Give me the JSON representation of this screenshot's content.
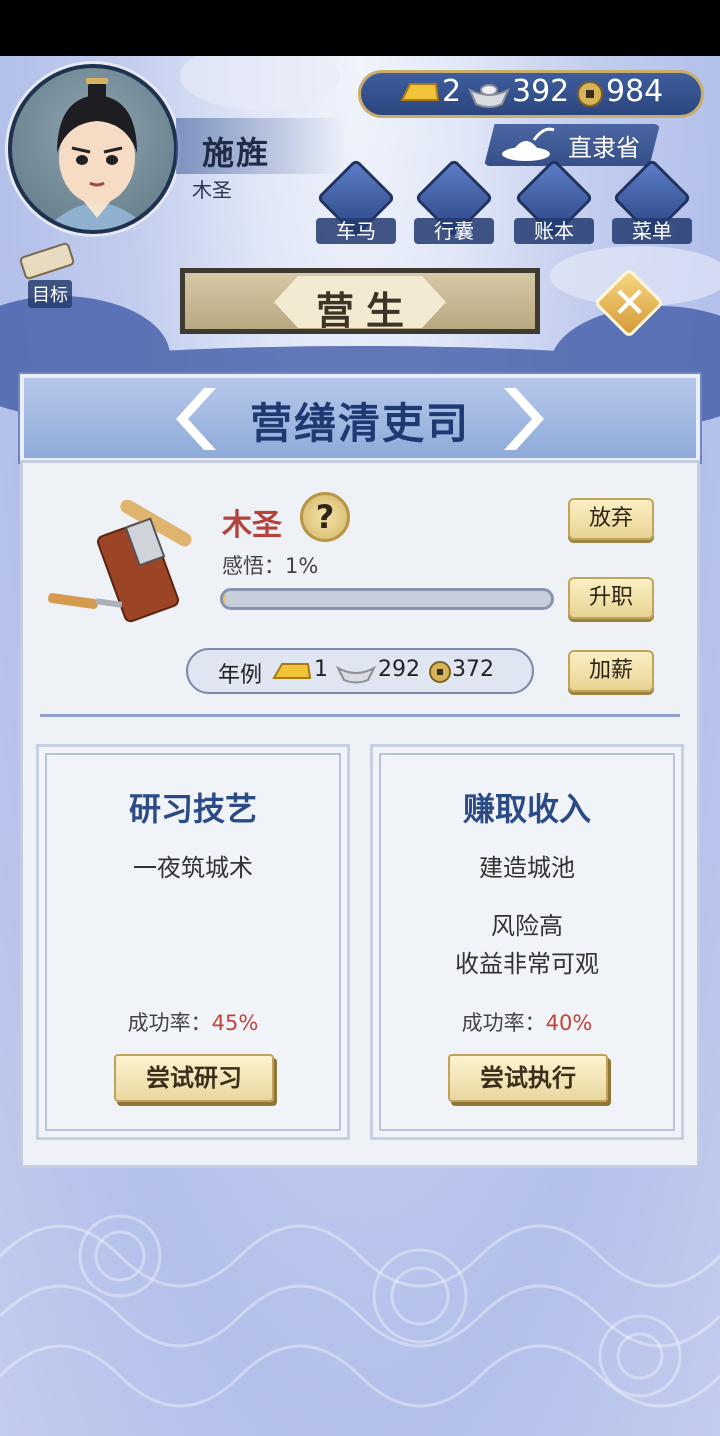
{
  "player": {
    "name": "施旌",
    "title": "木圣"
  },
  "currency": {
    "gold": "2",
    "silver": "392",
    "coins": "984"
  },
  "location": "直隶省",
  "nav": [
    {
      "label": "车马"
    },
    {
      "label": "行囊"
    },
    {
      "label": "账本"
    },
    {
      "label": "菜单"
    }
  ],
  "goal_label": "目标",
  "banner": "营生",
  "close_label": "✕",
  "office": "营缮清吏司",
  "job": {
    "name": "木圣",
    "help": "?",
    "insight_label": "感悟：",
    "insight_value": "1%",
    "insight_fraction": 0.01,
    "abandon": "放弃",
    "promote": "升职",
    "raise": "加薪",
    "salary_label": "年例",
    "salary_gold": "1",
    "salary_silver": "292",
    "salary_coins": "372"
  },
  "cards": [
    {
      "title": "研习技艺",
      "line1": "一夜筑城术",
      "line2": "",
      "line3": "",
      "rate_label": "成功率：",
      "rate_value": "45%",
      "button": "尝试研习"
    },
    {
      "title": "赚取收入",
      "line1": "建造城池",
      "line2": "风险高",
      "line3": "收益非常可观",
      "rate_label": "成功率：",
      "rate_value": "40%",
      "button": "尝试执行"
    }
  ]
}
